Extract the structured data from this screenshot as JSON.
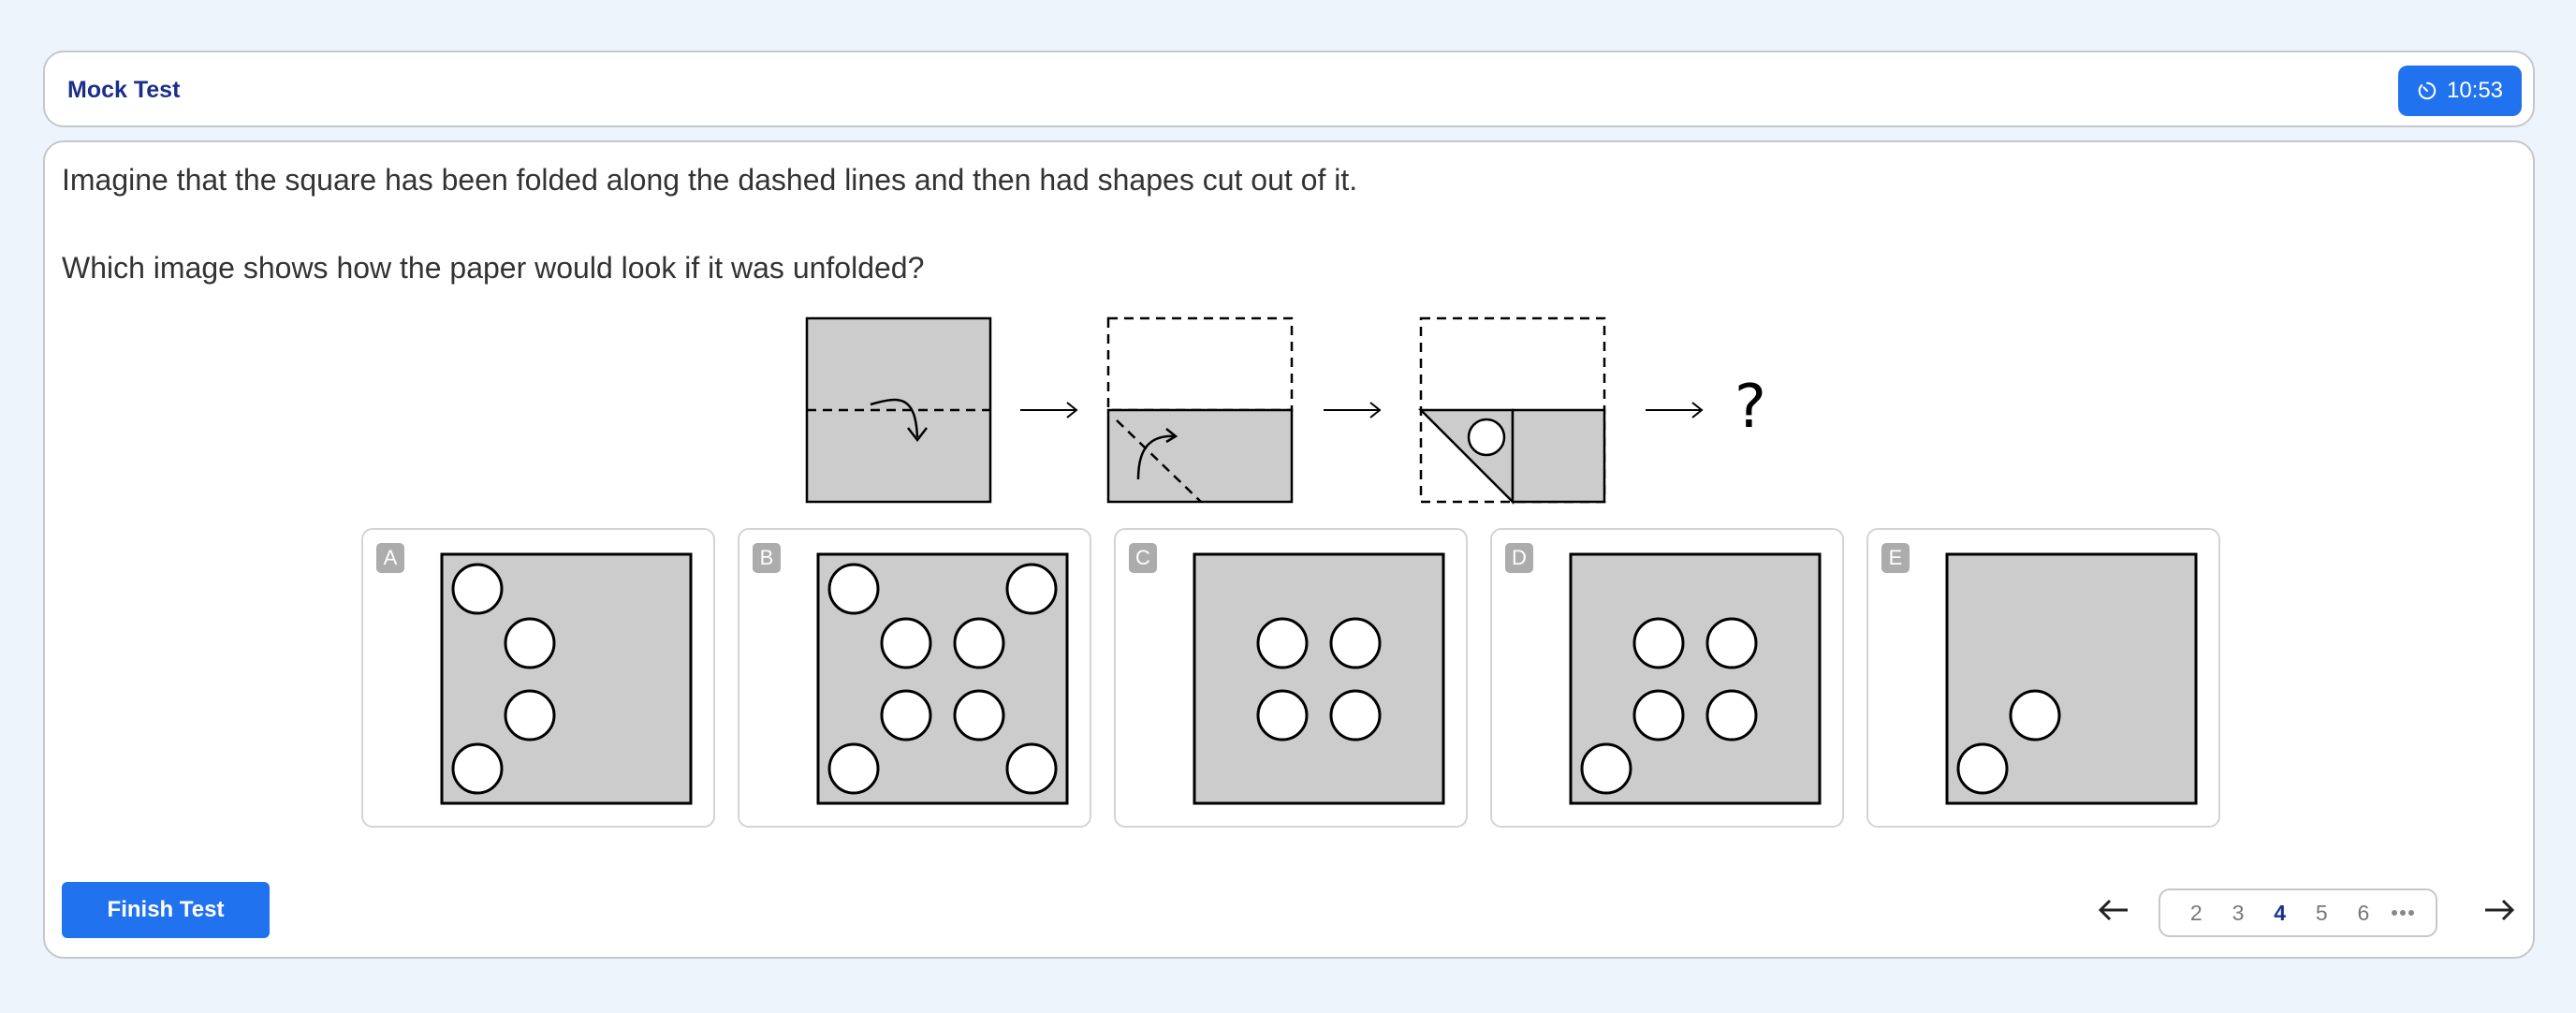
{
  "header": {
    "title": "Mock Test",
    "timer": "10:53",
    "timer_icon": "stopwatch-icon"
  },
  "question": {
    "line1": "Imagine that the square has been folded along the dashed lines and then had shapes cut out of it.",
    "line2": "Which image shows how the paper would look if it was unfolded?",
    "stem_question_mark": "?",
    "fold_steps": [
      {
        "step": 1,
        "description": "Full square, horizontal dashed fold line, curved arrow folding top down"
      },
      {
        "step": 2,
        "description": "Bottom half shown, diagonal dashed fold line, curved arrow folding left corner up-right"
      },
      {
        "step": 3,
        "description": "Folded triangle with one circle cut out"
      }
    ]
  },
  "options": [
    {
      "letter": "A",
      "holes": 4
    },
    {
      "letter": "B",
      "holes": 8
    },
    {
      "letter": "C",
      "holes": 4
    },
    {
      "letter": "D",
      "holes": 5
    },
    {
      "letter": "E",
      "holes": 2
    }
  ],
  "footer": {
    "finish_label": "Finish Test",
    "prev_icon": "arrow-left-icon",
    "next_icon": "arrow-right-icon",
    "pages": [
      "2",
      "3",
      "4",
      "5",
      "6"
    ],
    "current_page": "4",
    "more_icon": "ellipsis-icon"
  },
  "colors": {
    "accent": "#2172ef",
    "title": "#1b2f8a",
    "paper": "#cccccc",
    "background": "#eef4fc"
  }
}
